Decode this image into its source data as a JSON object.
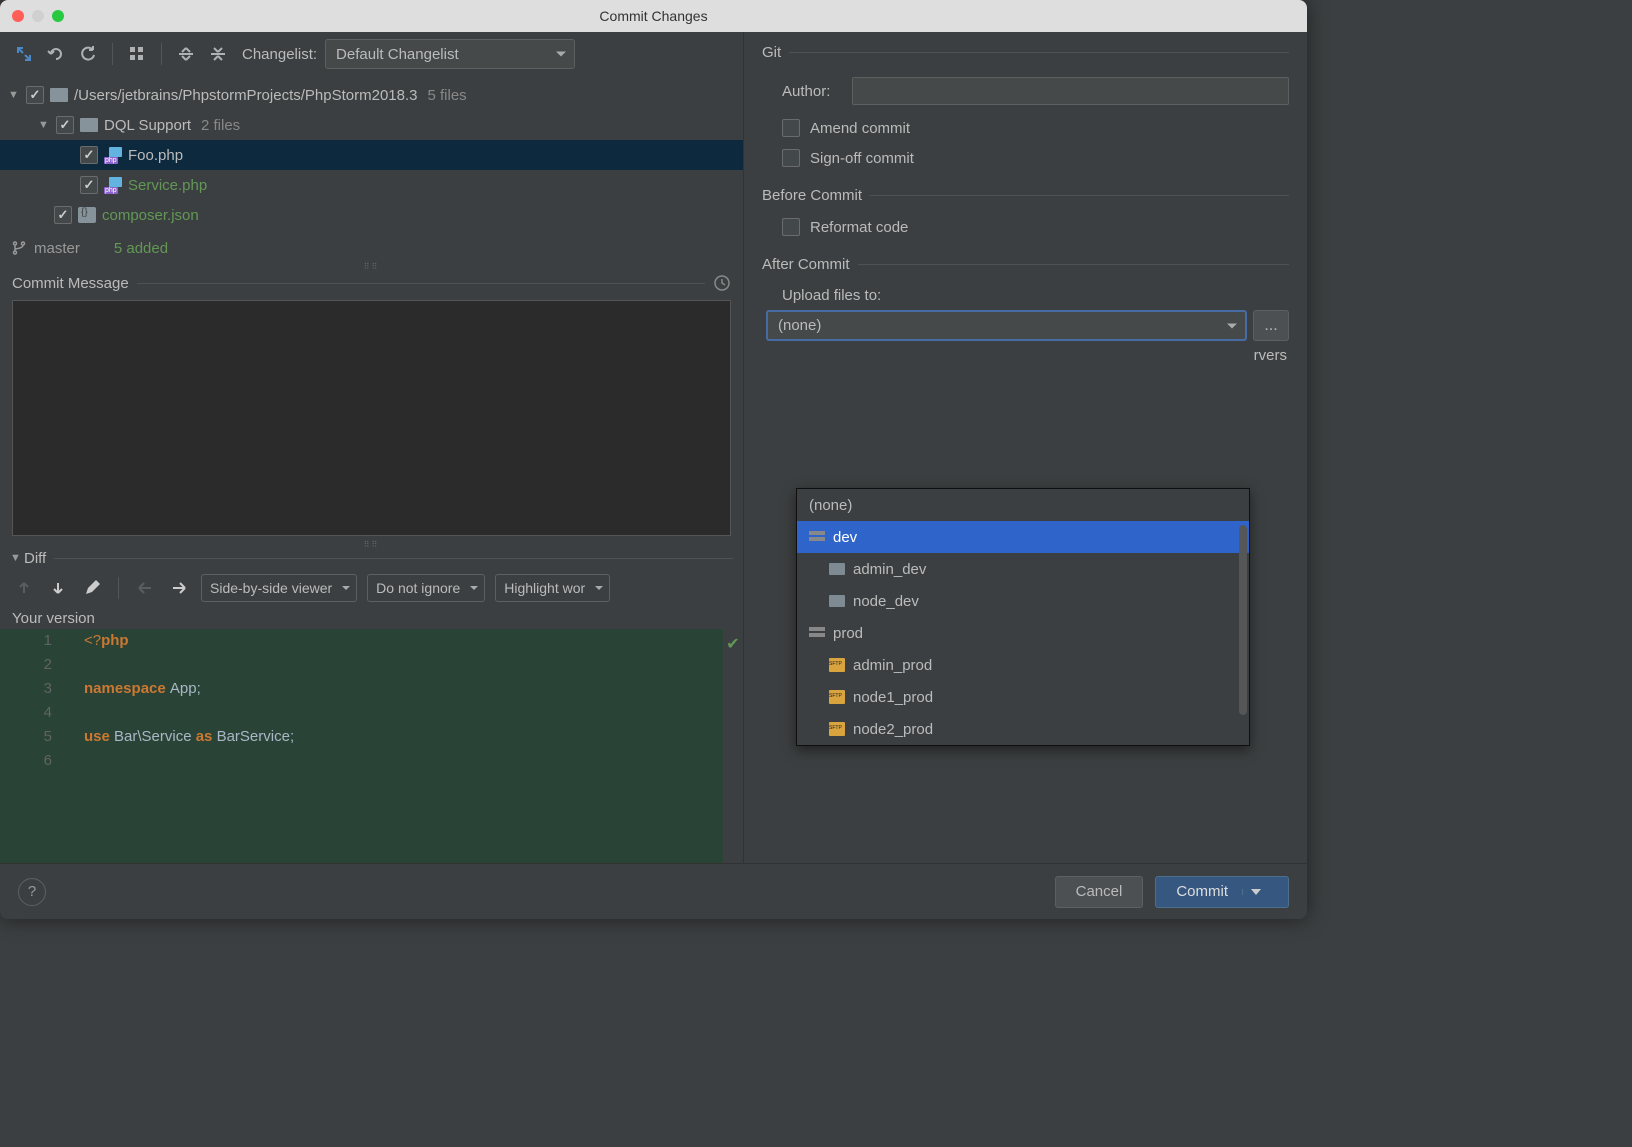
{
  "window": {
    "title": "Commit Changes"
  },
  "toolbar": {
    "changelist_label": "Changelist:",
    "changelist_value": "Default Changelist"
  },
  "tree": {
    "root": {
      "path": "/Users/jetbrains/PhpstormProjects/PhpStorm2018.3",
      "count": "5 files"
    },
    "folder": {
      "name": "DQL Support",
      "count": "2 files"
    },
    "files": [
      {
        "name": "Foo.php",
        "class": ""
      },
      {
        "name": "Service.php",
        "class": "green"
      },
      {
        "name": "composer.json",
        "class": "green"
      }
    ]
  },
  "branch": {
    "name": "master",
    "added": "5 added"
  },
  "commit_msg": {
    "label": "Commit Message"
  },
  "diff": {
    "label": "Diff",
    "viewer": "Side-by-side viewer",
    "ignore": "Do not ignore",
    "highlight": "Highlight wor",
    "version_label": "Your version",
    "lines": [
      "1",
      "2",
      "3",
      "4",
      "5",
      "6"
    ],
    "code": [
      "<?php",
      "",
      "namespace App;",
      "",
      "use Bar\\Service as BarService;",
      ""
    ]
  },
  "git": {
    "label": "Git",
    "author_label": "Author:",
    "amend": "Amend commit",
    "signoff": "Sign-off commit"
  },
  "before_commit": {
    "label": "Before Commit",
    "reformat": "Reformat code"
  },
  "after_commit": {
    "label": "After Commit",
    "upload_label": "Upload files to:",
    "upload_value": "(none)",
    "servers_hint": "rvers"
  },
  "dropdown_items": [
    {
      "text": "(none)",
      "icon": "",
      "indent": 0,
      "selected": false
    },
    {
      "text": "dev",
      "icon": "group",
      "indent": 0,
      "selected": true
    },
    {
      "text": "admin_dev",
      "icon": "server",
      "indent": 1,
      "selected": false
    },
    {
      "text": "node_dev",
      "icon": "server",
      "indent": 1,
      "selected": false
    },
    {
      "text": "prod",
      "icon": "group",
      "indent": 0,
      "selected": false
    },
    {
      "text": "admin_prod",
      "icon": "sftp",
      "indent": 1,
      "selected": false
    },
    {
      "text": "node1_prod",
      "icon": "sftp",
      "indent": 1,
      "selected": false
    },
    {
      "text": "node2_prod",
      "icon": "sftp",
      "indent": 1,
      "selected": false
    }
  ],
  "buttons": {
    "help": "?",
    "cancel": "Cancel",
    "commit": "Commit"
  }
}
